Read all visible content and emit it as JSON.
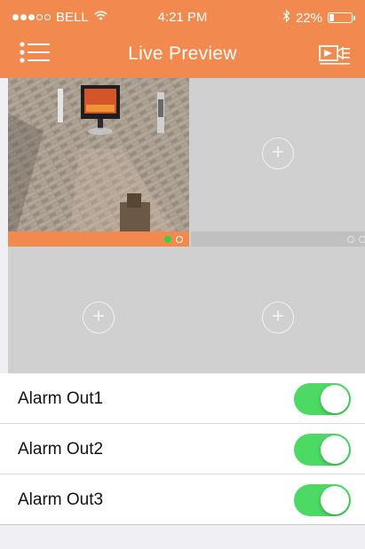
{
  "status_bar": {
    "carrier": "BELL",
    "time": "4:21 PM",
    "battery_percent": "22%",
    "battery_level": 0.22,
    "signal_bars": 3,
    "signal_max": 5,
    "icons": [
      "wifi-icon",
      "bluetooth-icon",
      "battery-icon"
    ]
  },
  "nav": {
    "title": "Live Preview",
    "menu_icon": "list-menu-icon",
    "right_icon": "video-playback-icon"
  },
  "preview_grid": {
    "channels": [
      {
        "slot": 1,
        "state": "live",
        "indicator_color": "#3ecf3e"
      },
      {
        "slot": 2,
        "state": "empty",
        "add_icon": "plus-circle-icon"
      },
      {
        "slot": 3,
        "state": "empty",
        "add_icon": "plus-circle-icon"
      },
      {
        "slot": 4,
        "state": "empty",
        "add_icon": "plus-circle-icon"
      }
    ]
  },
  "alarms": {
    "items": [
      {
        "label": "Alarm Out1",
        "on": true
      },
      {
        "label": "Alarm Out2",
        "on": true
      },
      {
        "label": "Alarm Out3",
        "on": true
      }
    ]
  },
  "colors": {
    "accent": "#f28a4f",
    "toggle_on": "#4cd964",
    "grid_empty": "#d0d0d0"
  }
}
